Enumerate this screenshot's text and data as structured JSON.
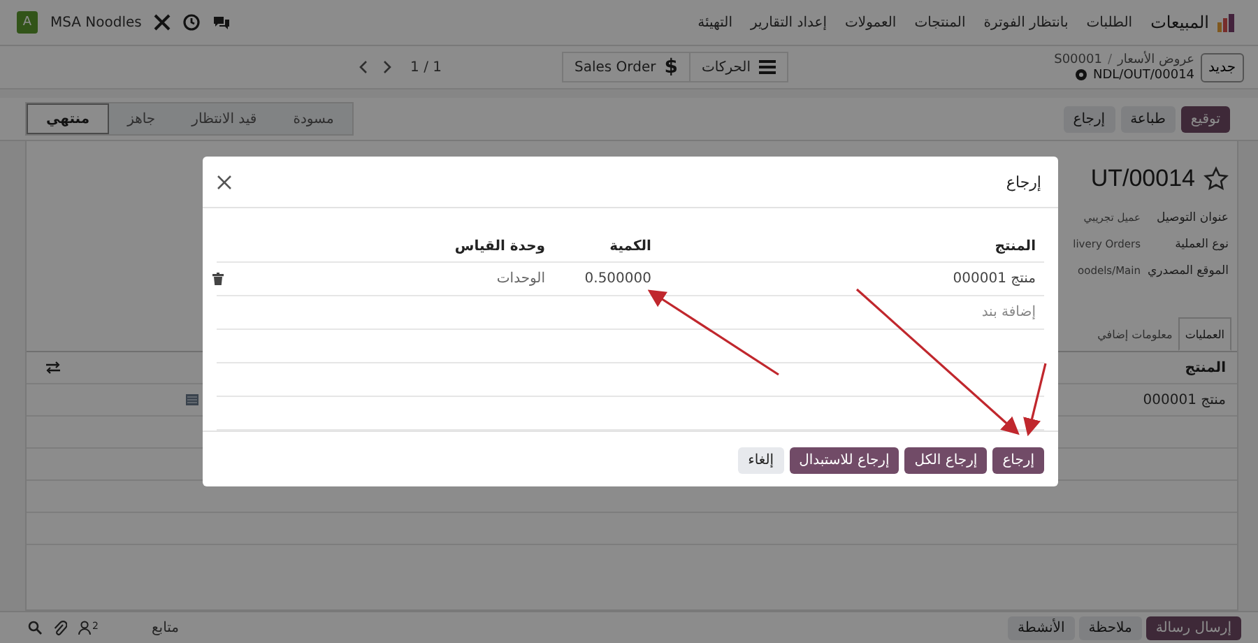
{
  "navbar": {
    "app_name": "المبيعات",
    "menu": [
      "الطلبات",
      "بانتظار الفوترة",
      "المنتجات",
      "العمولات",
      "إعداد التقارير",
      "التهيئة"
    ],
    "company": "MSA Noodles",
    "avatar": "A"
  },
  "control_panel": {
    "new_button": "جديد",
    "breadcrumb_parent": "عروض الأسعار",
    "breadcrumb_separator": "/",
    "breadcrumb_record": "S00001",
    "current_record": "NDL/OUT/00014",
    "smart_buttons": [
      {
        "label": "الحركات",
        "kind": "list"
      },
      {
        "label": "Sales Order",
        "kind": "glyph",
        "glyph": "$"
      }
    ],
    "pager": "1 / 1"
  },
  "actions": [
    {
      "label": "توقيع",
      "primary": true
    },
    {
      "label": "طباعة",
      "primary": false
    },
    {
      "label": "إرجاع",
      "primary": false
    }
  ],
  "statusbar": [
    {
      "label": "مسودة",
      "selected": false
    },
    {
      "label": "قيد الانتظار",
      "selected": false
    },
    {
      "label": "جاهز",
      "selected": false
    },
    {
      "label": "منتهي",
      "selected": true
    }
  ],
  "form": {
    "title": "UT/00014",
    "fields": [
      {
        "label": "عنوان التوصيل",
        "value": "عميل تجريبي"
      },
      {
        "label": "نوع العملية",
        "value": "livery Orders"
      },
      {
        "label": "الموقع المصدري",
        "value": "oodels/Main"
      }
    ],
    "tabs": [
      {
        "label": "العمليات",
        "selected": true
      },
      {
        "label": "معلومات إضافي",
        "selected": false
      }
    ],
    "table": {
      "columns": [
        "المنتج"
      ],
      "rows": [
        [
          "منتج 000001"
        ]
      ]
    }
  },
  "chatter": {
    "buttons": [
      {
        "label": "إرسال رسالة",
        "primary": true
      },
      {
        "label": "ملاحظة",
        "primary": false
      },
      {
        "label": "الأنشطة",
        "primary": false
      }
    ],
    "follower_count": "2",
    "follow": "متابع"
  },
  "dialog": {
    "title": "إرجاع",
    "columns": [
      "المنتج",
      "الكمية",
      "وحدة القياس"
    ],
    "rows": [
      [
        "منتج 000001",
        "0.500000",
        "الوحدات"
      ]
    ],
    "add_line": "إضافة بند",
    "buttons": [
      {
        "label": "إرجاع",
        "primary": true
      },
      {
        "label": "إرجاع الكل",
        "primary": true
      },
      {
        "label": "إرجاع للاستبدال",
        "primary": true
      },
      {
        "label": "إلغاء",
        "primary": false
      }
    ]
  }
}
